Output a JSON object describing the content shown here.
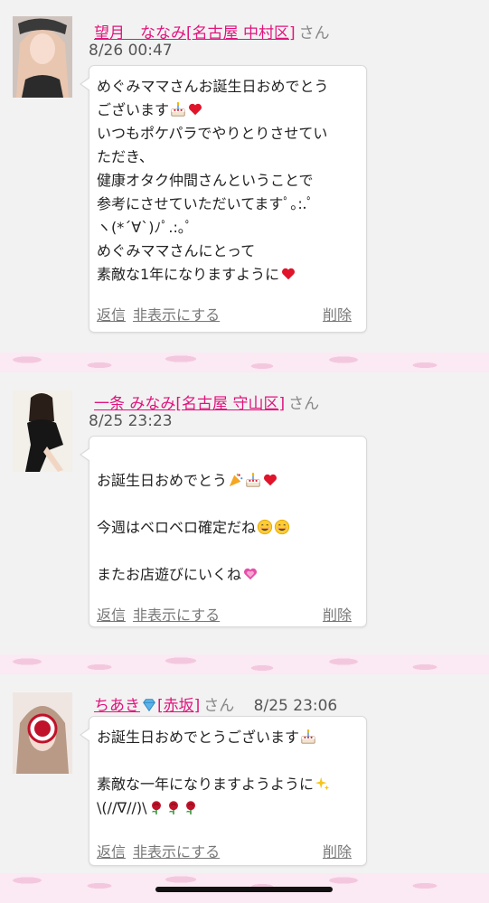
{
  "entries": [
    {
      "name": "望月　ななみ[名古屋 中村区]",
      "san": "さん",
      "date": "8/26 00:47",
      "lines": [
        "めぐみママさんお誕生日おめでとう",
        "ございます",
        "いつもポケパラでやりとりさせてい",
        "ただき、",
        "健康オタク仲間さんということで",
        "参考にさせていただいてますﾟ｡:.ﾟ",
        "ヽ(*´∀`)ﾉﾟ.:｡ﾟ",
        "めぐみママさんにとって",
        "素敵な1年になりますように"
      ]
    },
    {
      "name": "一条 みなみ[名古屋 守山区]",
      "san": "さん",
      "date": "8/25 23:23",
      "lines": [
        "お誕生日おめでとう",
        "",
        "今週はベロベロ確定だね",
        "",
        "またお店遊びにいくね"
      ]
    },
    {
      "name": "ちあき[赤坂]",
      "san": "さん",
      "date": "8/25 23:06",
      "lines": [
        "お誕生日おめでとうございます",
        "",
        "素敵な一年になりますようように",
        "\\(//∇//)\\"
      ]
    }
  ],
  "actions": {
    "reply": "返信",
    "hide": "非表示にする",
    "delete": "削除"
  },
  "colors": {
    "name_link": "#e0147c",
    "heart": "#e0142a",
    "divider_pink": "#f3c8de"
  },
  "icons": [
    "cake-icon",
    "heart-icon",
    "party-popper-icon",
    "smile-icon",
    "pink-heart-icon",
    "diamond-icon",
    "sparkles-icon",
    "rose-icon"
  ]
}
